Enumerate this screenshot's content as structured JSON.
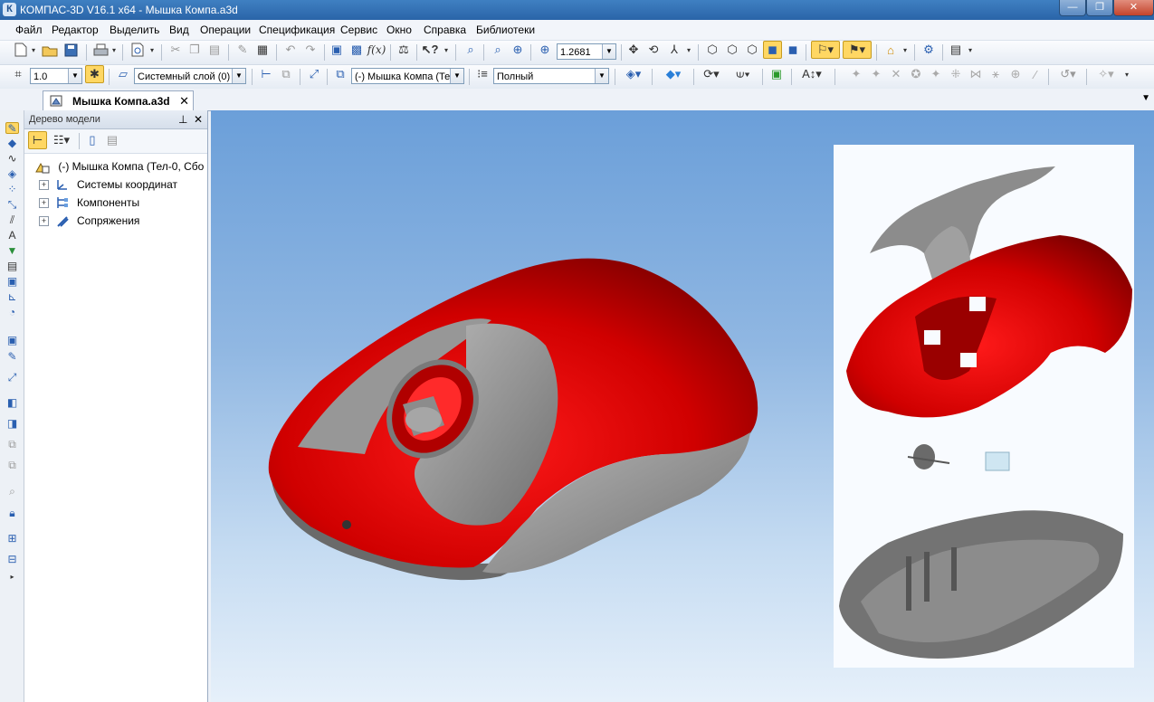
{
  "window": {
    "title": "КОМПАС-3D V16.1 x64 - Мышка Компа.a3d",
    "app_icon": "К",
    "controls": {
      "minimize": "—",
      "maximize": "❐",
      "close": "✕"
    }
  },
  "menu": [
    "Файл",
    "Редактор",
    "Выделить",
    "Вид",
    "Операции",
    "Спецификация",
    "Сервис",
    "Окно",
    "Справка",
    "Библиотеки"
  ],
  "toolbar1": {
    "zoom_value": "1.2681"
  },
  "toolbar2": {
    "step_value": "1.0",
    "layer_value": "Системный слой (0)",
    "component_value": "(-) Мышка Компа (Те",
    "display_mode_value": "Полный"
  },
  "document_tab": {
    "label": "Мышка Компа.a3d",
    "close": "✕"
  },
  "tree_panel": {
    "title": "Дерево модели",
    "pin": "⊥",
    "close": "✕",
    "root_label": "(-) Мышка Компа (Тел-0, Сбо",
    "items": [
      {
        "label": "Системы координат",
        "expander": "+"
      },
      {
        "label": "Компоненты",
        "expander": "+"
      },
      {
        "label": "Сопряжения",
        "expander": "+"
      }
    ]
  },
  "colors": {
    "mouse_red": "#d40000",
    "mouse_gray": "#8f8f8f",
    "viewport_top": "#6b9fd9",
    "viewport_bottom": "#e6f0fa"
  },
  "icons": {
    "tree_root": "assembly-icon",
    "coord": "coordinate-system-icon",
    "components": "components-icon",
    "mates": "mates-icon"
  }
}
